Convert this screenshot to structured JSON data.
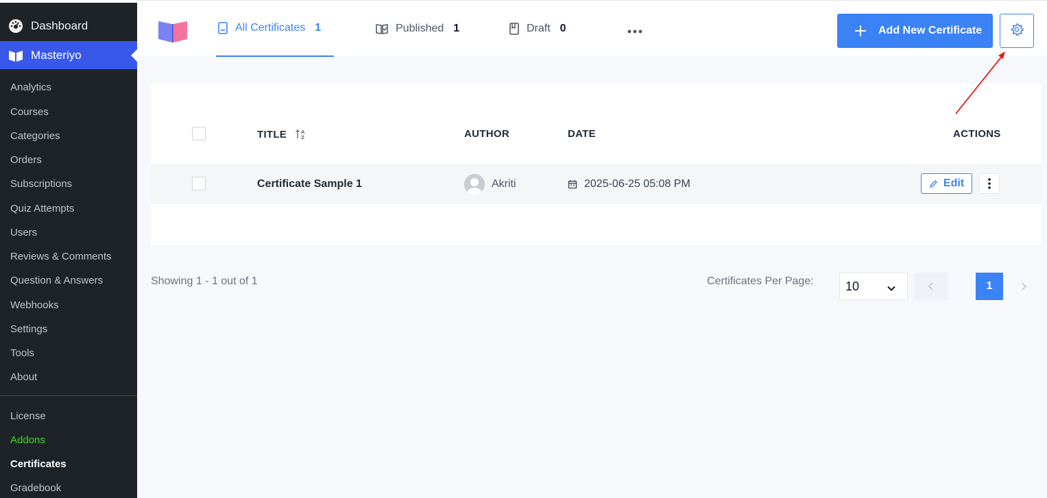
{
  "sidebar": {
    "dashboard": "Dashboard",
    "plugin": "Masteriyo",
    "items": [
      "Analytics",
      "Courses",
      "Categories",
      "Orders",
      "Subscriptions",
      "Quiz Attempts",
      "Users",
      "Reviews & Comments",
      "Question & Answers",
      "Webhooks",
      "Settings",
      "Tools",
      "About"
    ],
    "items2": [
      "License",
      "Addons",
      "Certificates",
      "Gradebook"
    ]
  },
  "tabs": [
    {
      "label": "All Certificates",
      "count": "1"
    },
    {
      "label": "Published",
      "count": "1"
    },
    {
      "label": "Draft",
      "count": "0"
    }
  ],
  "header": {
    "add_label": "Add New Certificate"
  },
  "table": {
    "columns": {
      "title": "TITLE",
      "author": "AUTHOR",
      "date": "DATE",
      "actions": "ACTIONS"
    },
    "rows": [
      {
        "title": "Certificate Sample 1",
        "author": "Akriti",
        "date": "2025-06-25 05:08 PM",
        "edit": "Edit"
      }
    ]
  },
  "footer": {
    "showing": "Showing 1 - 1 out of 1",
    "per_page_label": "Certificates Per Page:",
    "per_page_value": "10",
    "current_page": "1"
  },
  "colors": {
    "accent": "#3b82f6",
    "sidebar": "#1d2327",
    "sidebar_active": "#3858e9",
    "addons": "#44d62c",
    "annotation": "#e0201b"
  }
}
